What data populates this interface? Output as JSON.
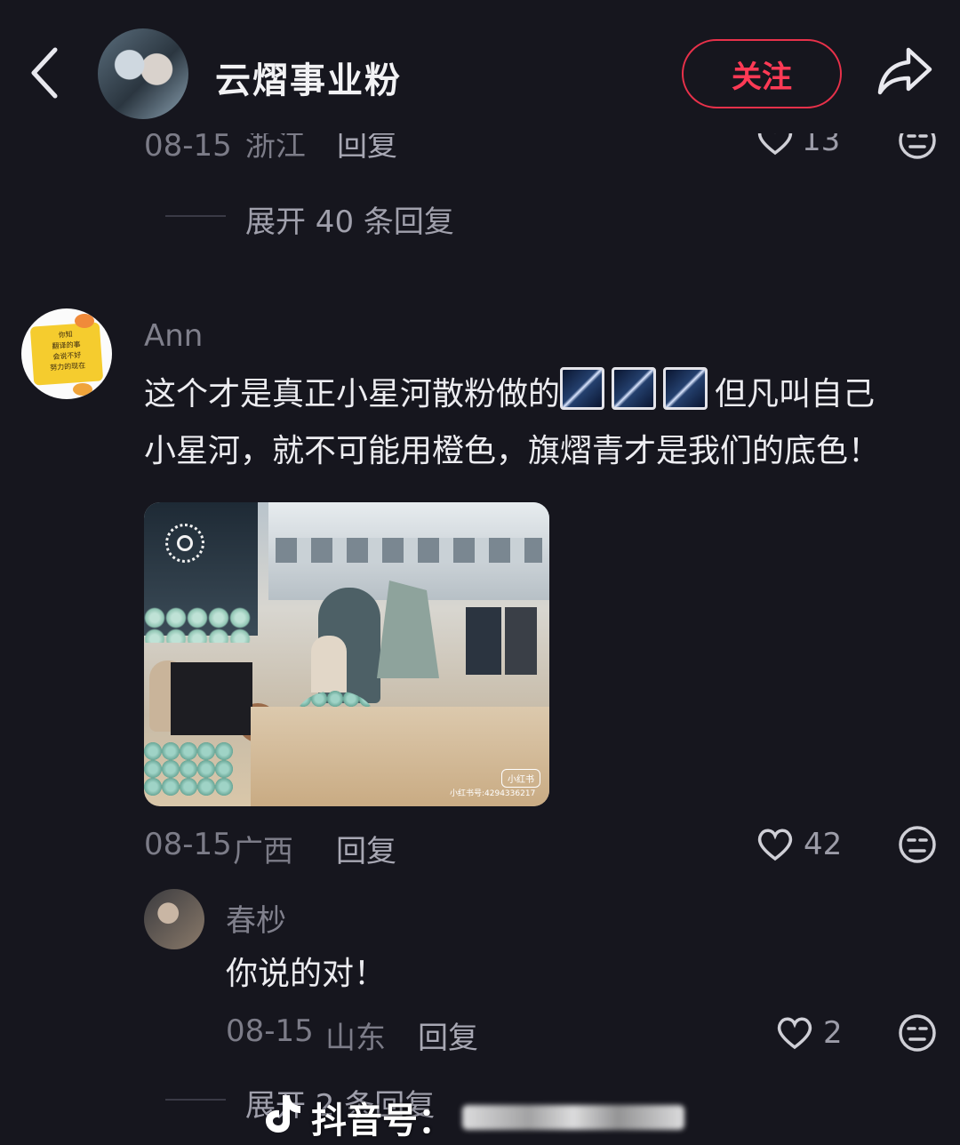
{
  "header": {
    "title": "云熠事业粉",
    "follow_label": "关注"
  },
  "prev_comment": {
    "date": "08-15",
    "location": "浙江",
    "reply_label": "回复",
    "likes": "13",
    "expand_label": "展开 40 条回复"
  },
  "comment": {
    "author": "Ann",
    "text_line1": "这个才是真正小星河散粉做的",
    "text_line1_after": "但凡叫自己",
    "text_line2": "小星河，就不可能用橙色，旗熠青才是我们的底色！",
    "date": "08-15",
    "location": "广西",
    "reply_label": "回复",
    "likes": "42",
    "photo_watermark": "小红书号:4294336217",
    "photo_badge": "小红书"
  },
  "reply": {
    "author": "春杪",
    "text": "你说的对！",
    "date": "08-15",
    "location": "山东",
    "reply_label": "回复",
    "likes": "2",
    "expand_label": "展开 2 条回复"
  },
  "watermark": {
    "label": "抖音号："
  },
  "avatar_ann_text": [
    "你知",
    "翻译的事",
    "会说不好",
    "努力的现在"
  ]
}
